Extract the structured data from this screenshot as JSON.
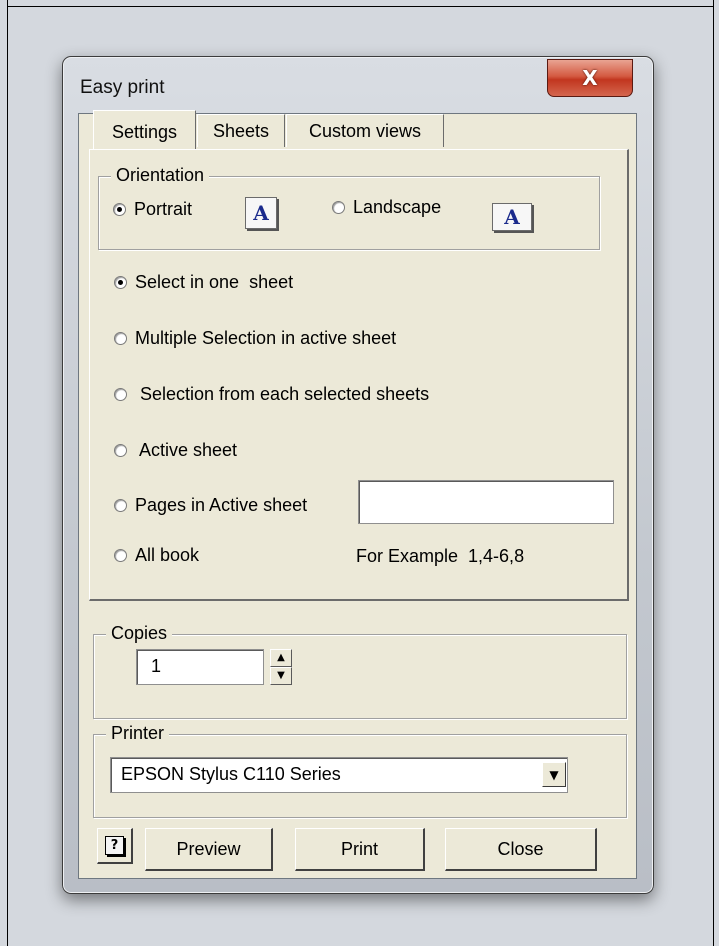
{
  "dialog": {
    "title": "Easy print",
    "close_glyph": "X"
  },
  "tabs": [
    {
      "label": "Settings",
      "active": true
    },
    {
      "label": "Sheets",
      "active": false
    },
    {
      "label": "Custom views",
      "active": false
    }
  ],
  "orientation": {
    "legend": "Orientation",
    "portrait_label": "Portrait",
    "landscape_label": "Landscape",
    "selected": "Portrait",
    "portrait_icon": "portrait-icon",
    "landscape_icon": "landscape-icon",
    "icon_glyph": "A"
  },
  "print_scope": {
    "options": [
      {
        "label": "Select in one  sheet",
        "selected": true
      },
      {
        "label": "Multiple Selection in active sheet",
        "selected": false
      },
      {
        "label": " Selection from each selected sheets",
        "selected": false
      },
      {
        "label": " Active sheet",
        "selected": false
      },
      {
        "label": "Pages in Active sheet",
        "selected": false
      },
      {
        "label": "All book",
        "selected": false
      }
    ],
    "pages_value": "",
    "example_text": "For Example  1,4-6,8"
  },
  "copies": {
    "legend": "Copies",
    "value": "1",
    "up_glyph": "▲",
    "down_glyph": "▼"
  },
  "printer": {
    "legend": "Printer",
    "selected": "EPSON Stylus C110 Series",
    "arrow_glyph": "▼"
  },
  "buttons": {
    "help_glyph": "?",
    "preview": "Preview",
    "print": "Print",
    "close": "Close"
  }
}
